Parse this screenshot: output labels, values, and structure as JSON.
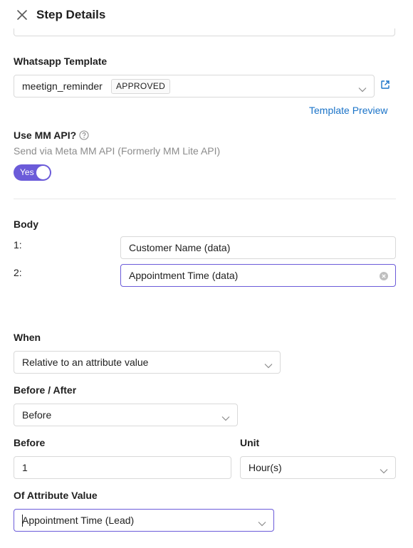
{
  "header": {
    "title": "Step Details",
    "close_icon": "close-icon"
  },
  "whatsapp_template": {
    "label": "Whatsapp Template",
    "selected": "meetign_reminder",
    "status": "APPROVED",
    "preview_link": "Template Preview",
    "external_icon": "external-link-icon"
  },
  "mm_api": {
    "label": "Use MM API?",
    "description": "Send via Meta MM API (Formerly MM Lite API)",
    "toggle_label": "Yes",
    "toggle_on": true
  },
  "body": {
    "label": "Body",
    "rows": [
      {
        "index": "1:",
        "value": "Customer Name (data)"
      },
      {
        "index": "2:",
        "value": "Appointment Time (data)"
      }
    ]
  },
  "when": {
    "label": "When",
    "selected": "Relative to an attribute value"
  },
  "before_after": {
    "label": "Before / After",
    "selected": "Before"
  },
  "offset": {
    "label": "Before",
    "value": "1"
  },
  "unit": {
    "label": "Unit",
    "selected": "Hour(s)"
  },
  "attribute": {
    "label": "Of Attribute Value",
    "selected": "Appointment Time (Lead)"
  },
  "colors": {
    "accent": "#6b5bd9",
    "link": "#1a73c8",
    "border": "#d9d9d9",
    "muted": "#8c8c8c"
  }
}
